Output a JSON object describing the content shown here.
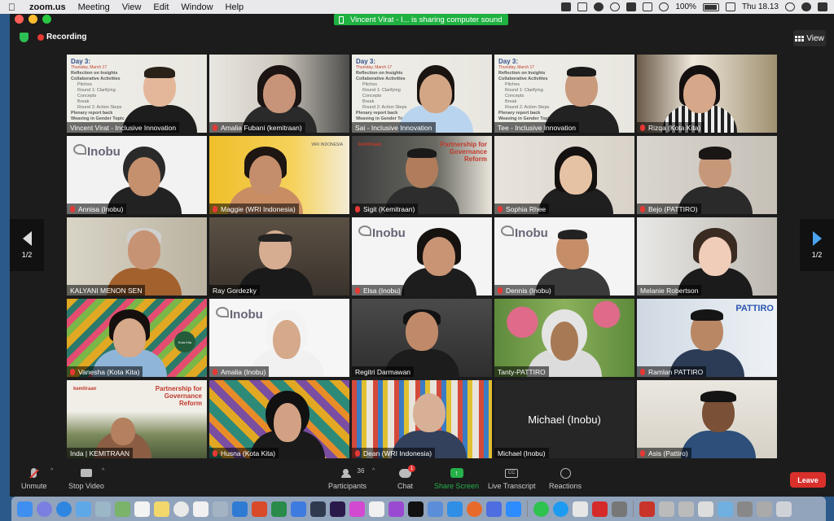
{
  "menubar": {
    "app_name": "zoom.us",
    "items": [
      "Meeting",
      "View",
      "Edit",
      "Window",
      "Help"
    ],
    "battery": "100%",
    "clock": "Thu 18.13"
  },
  "banner": {
    "text": "Vincent Virat - I... is sharing computer sound"
  },
  "meeting": {
    "recording_label": "Recording",
    "view_label": "View",
    "page_left": "1/2",
    "page_right": "1/2",
    "michael_center_label": "Michael (Inobu)"
  },
  "slide": {
    "day": "Day 3:",
    "date": "Thursday, March 17",
    "lines": [
      "Reflection on Insights",
      "Collaborative Activities"
    ],
    "sub_lines": [
      "Pitches",
      "Round 1: Clarifying Concepts",
      "Break",
      "Round 2: Action Steps"
    ],
    "more_lines": [
      "Plenary report back",
      "Weaving in Gender Topic"
    ]
  },
  "logos": {
    "inobu": "Inobu",
    "kemitraan": "kemitraan",
    "pfgr": "Partnership for Governance Reform",
    "pattiro": "PATTIRO",
    "wri": "WRI INDONESIA",
    "kota_kita_badge": "Kota Kita"
  },
  "participants": [
    {
      "name": "Vincent Virat - Inclusive Innovation",
      "muted": false
    },
    {
      "name": "Amalia Fubani (kemitraan)",
      "muted": true
    },
    {
      "name": "Sai - Inclusive Innovation",
      "muted": false
    },
    {
      "name": "Tee - Inclusive Innovation",
      "muted": false
    },
    {
      "name": "Rizqa (Kota Kita)",
      "muted": true
    },
    {
      "name": "Annisa (Inobu)",
      "muted": true
    },
    {
      "name": "Maggie (WRI Indonesia)",
      "muted": true
    },
    {
      "name": "Sigit (Kemitraan)",
      "muted": true
    },
    {
      "name": "Sophia Rhee",
      "muted": true
    },
    {
      "name": "Bejo (PATTIRO)",
      "muted": true
    },
    {
      "name": "KALYANI MENON SEN",
      "muted": false
    },
    {
      "name": "Ray Gordezky",
      "muted": false
    },
    {
      "name": "Elsa (Inobu)",
      "muted": true
    },
    {
      "name": "Dennis (Inobu)",
      "muted": true
    },
    {
      "name": "Melanie Robertson",
      "muted": false
    },
    {
      "name": "Vanesha (Kota Kita)",
      "muted": true
    },
    {
      "name": "Amalia (Inobu)",
      "muted": true
    },
    {
      "name": "Regitri Darmawan",
      "muted": false
    },
    {
      "name": "Tanty-PATTIRO",
      "muted": false
    },
    {
      "name": "Ramlan PATTIRO",
      "muted": true
    },
    {
      "name": "Inda | KEMITRAAN",
      "muted": false
    },
    {
      "name": "Husna (Kota Kita)",
      "muted": true
    },
    {
      "name": "Dean (WRI Indonesia)",
      "muted": true
    },
    {
      "name": "Michael (Inobu)",
      "muted": false
    },
    {
      "name": "Asis (Pattiro)",
      "muted": true
    }
  ],
  "toolbar": {
    "unmute": "Unmute",
    "stop_video": "Stop Video",
    "participants": "Participants",
    "participant_count": "36",
    "chat": "Chat",
    "chat_badge": "1",
    "share_screen": "Share Screen",
    "live_transcript": "Live Transcript",
    "cc": "CC",
    "reactions": "Reactions",
    "leave": "Leave"
  },
  "colors": {
    "accent_green": "#26b14b",
    "leave_red": "#d9302c",
    "active_speaker": "#e2d533"
  }
}
